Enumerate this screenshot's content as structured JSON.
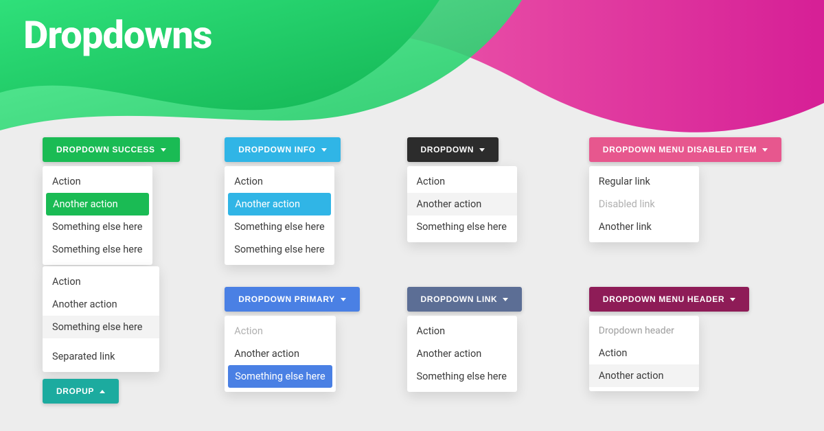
{
  "page": {
    "title": "Dropdowns"
  },
  "success": {
    "label": "DROPDOWN SUCCESS",
    "items": [
      "Action",
      "Another action",
      "Something else here",
      "Something else here"
    ]
  },
  "info": {
    "label": "DROPDOWN INFO",
    "items": [
      "Action",
      "Another action",
      "Something else here",
      "Something else here"
    ]
  },
  "dark": {
    "label": "DROPDOWN",
    "items": [
      "Action",
      "Another action",
      "Something else here"
    ]
  },
  "disabled": {
    "label": "DROPDOWN MENU DISABLED ITEM",
    "items": [
      "Regular link",
      "Disabled link",
      "Another link"
    ]
  },
  "dropup": {
    "label": "DROPUP",
    "items": [
      "Action",
      "Another action",
      "Something else here",
      "Separated link"
    ]
  },
  "primary": {
    "label": "DROPDOWN PRIMARY",
    "items": [
      "Action",
      "Another action",
      "Something else here"
    ]
  },
  "link": {
    "label": "DROPDOWN LINK",
    "items": [
      "Action",
      "Another action",
      "Something else here"
    ]
  },
  "header": {
    "label": "DROPDOWN MENU HEADER",
    "header": "Dropdown header",
    "items": [
      "Action",
      "Another action"
    ]
  }
}
